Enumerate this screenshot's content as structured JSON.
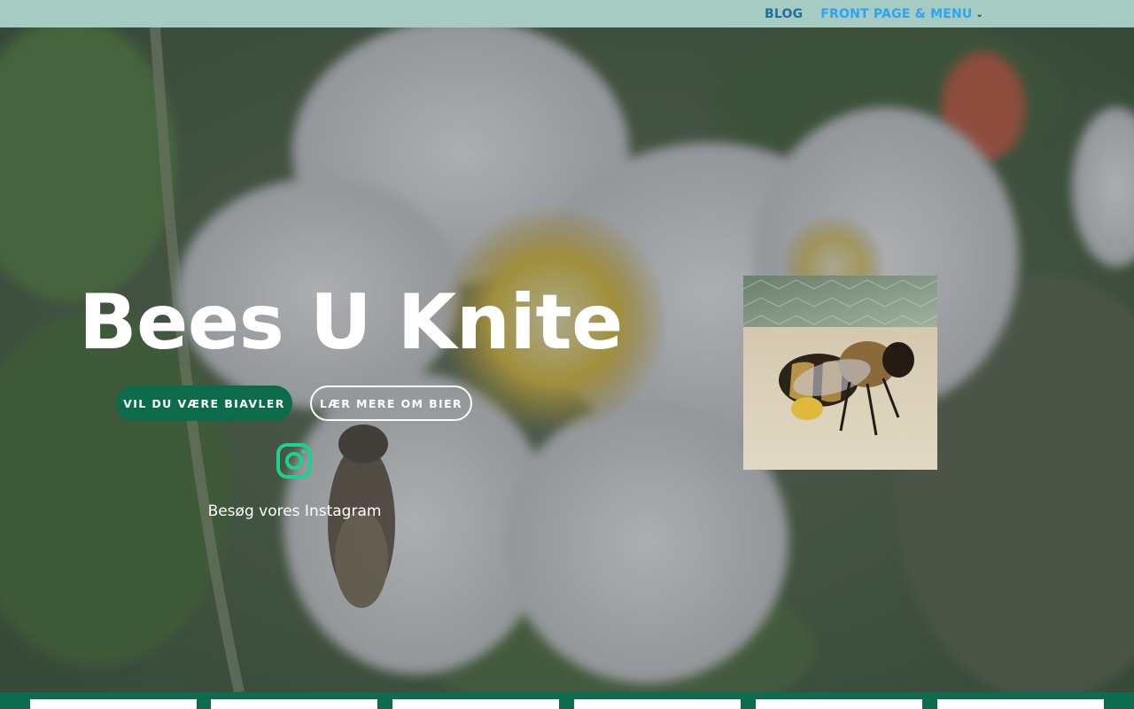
{
  "nav": {
    "blog_label": "BLOG",
    "front_label": "FRONT PAGE & MENU",
    "chevron_icon": "chevron-down-icon"
  },
  "hero": {
    "title": "Bees U Knite",
    "primary_button": "VIL DU VÆRE BIAVLER",
    "secondary_button": "LÆR MERE OM BIER",
    "instagram_icon": "instagram-icon",
    "instagram_caption": "Besøg vores Instagram"
  },
  "colors": {
    "topbar": "#a5cbc3",
    "nav_link": "#1f6f9a",
    "nav_active": "#2ea3f2",
    "primary_button": "#0b6b4a",
    "instagram_icon": "#1fd18f",
    "bottom_strip": "#0d6b4e"
  },
  "bottom_cards": {
    "count": 6
  }
}
